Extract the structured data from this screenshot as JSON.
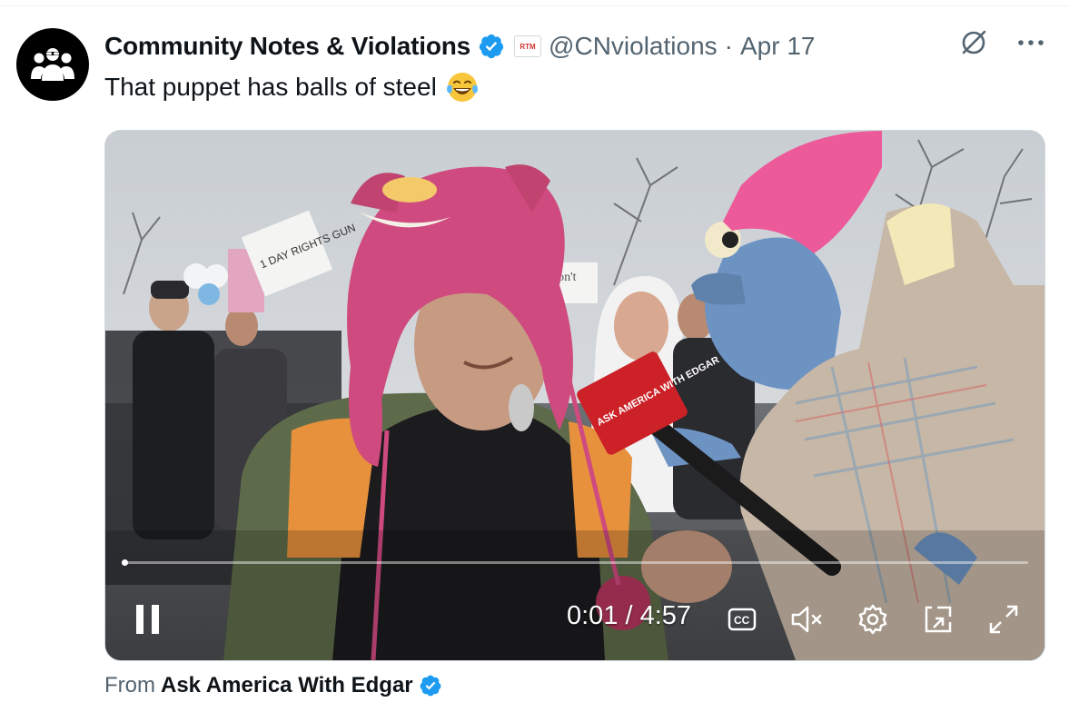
{
  "tweet": {
    "display_name": "Community Notes & Violations",
    "verified": true,
    "affiliate_badge_text": "RTM",
    "handle": "@CNviolations",
    "separator": "·",
    "date": "Apr 17",
    "text": "That puppet has balls of steel",
    "emoji": "😂"
  },
  "header_icons": [
    "grok-icon",
    "more-icon"
  ],
  "video": {
    "current_time": "0:01",
    "duration": "4:57",
    "time_display": "0:01 / 4:57",
    "progress_fraction": 0.003,
    "state": "playing",
    "muted": true,
    "scene_text": {
      "mic_flag": "ASK AMERICA WITH EDGAR",
      "sign_left": "1 DAY RIGHTS GUN",
      "sign_center": "won't"
    }
  },
  "source": {
    "prefix": "From",
    "name": "Ask America With Edgar",
    "verified": true
  },
  "colors": {
    "verified_blue": "#1d9bf0",
    "text_primary": "#0f1419",
    "text_secondary": "#536471",
    "affiliate_red": "#d0342c"
  }
}
